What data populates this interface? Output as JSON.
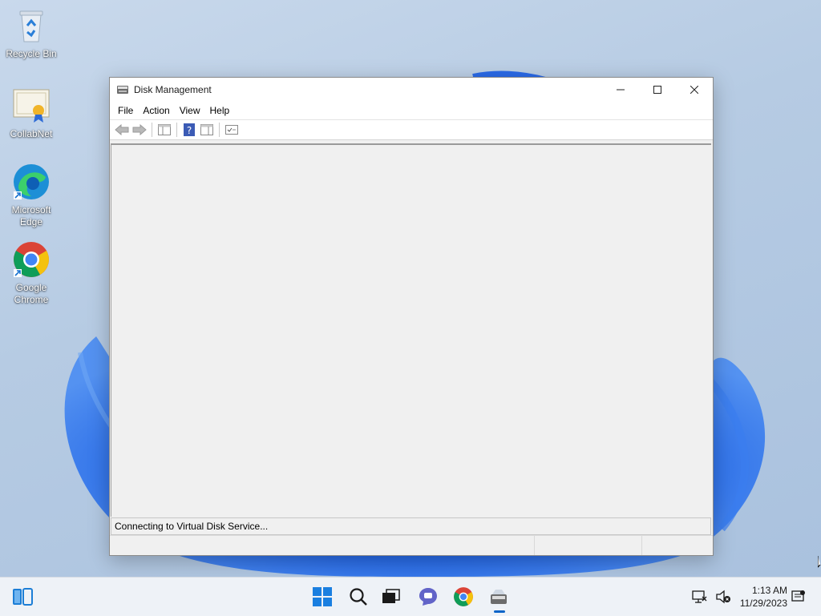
{
  "desktop": {
    "icons": [
      {
        "label": "Recycle Bin"
      },
      {
        "label": "CollabNet"
      },
      {
        "label": "Microsoft Edge"
      },
      {
        "label": "Google Chrome"
      }
    ]
  },
  "window": {
    "title": "Disk Management",
    "menu": [
      "File",
      "Action",
      "View",
      "Help"
    ],
    "toolbar_icons": [
      "back-arrow-icon",
      "forward-arrow-icon",
      "show-hide-console-tree-icon",
      "help-icon",
      "show-hide-action-pane-icon",
      "properties-icon"
    ],
    "status_message": "Connecting to Virtual Disk Service..."
  },
  "taskbar": {
    "clock_time": "1:13 AM",
    "clock_date": "11/29/2023"
  },
  "colors": {
    "accent": "#0a64c8",
    "window_bg": "#f0f0f0",
    "wallpaper_blue": "#1f5fe0"
  }
}
